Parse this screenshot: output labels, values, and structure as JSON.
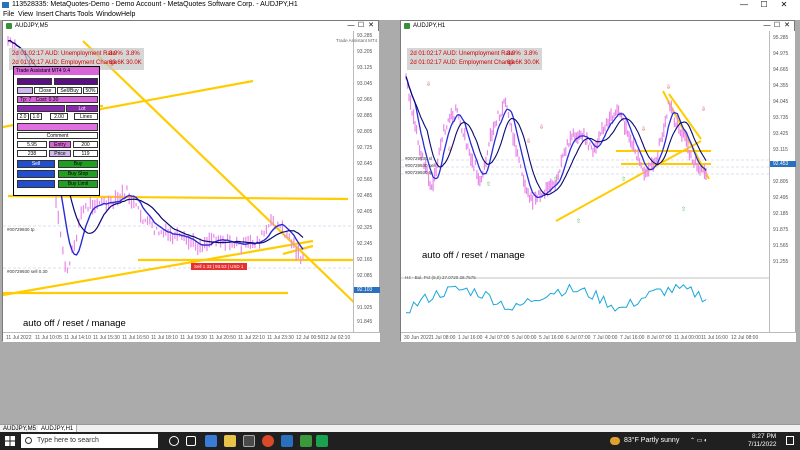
{
  "window": {
    "title": "113528335: MetaQuotes-Demo - Demo Account - MetaQuotes Software Corp. - AUDJPY,H1",
    "controls": {
      "minimize": "—",
      "maximize": "☐",
      "close": "✕"
    }
  },
  "menu": [
    "File",
    "View",
    "Insert",
    "Charts",
    "Tools",
    "Window",
    "Help"
  ],
  "chart_left": {
    "title": "AUDJPY,M5",
    "brand": "Trade Assistant MT4",
    "news": [
      {
        "time": "2d 01:02:17",
        "text": "AUD: Unemployment Rate",
        "v1": "3.9%",
        "v2": "3.8%"
      },
      {
        "time": "2d 01:02:17",
        "text": "AUD: Employment Change",
        "v1": "60.6K",
        "v2": "30.0K"
      }
    ],
    "price_ticks": [
      "93.285",
      "93.205",
      "93.125",
      "93.045",
      "92.965",
      "92.885",
      "92.805",
      "92.725",
      "92.645",
      "92.565",
      "92.485",
      "92.405",
      "92.325",
      "92.245",
      "92.165",
      "92.085",
      "92.005",
      "91.925",
      "91.845"
    ],
    "current_price": "92.103",
    "time_ticks": [
      "11 Jul 2022",
      "11 Jul 10:05",
      "11 Jul 14:10",
      "11 Jul 15:30",
      "11 Jul 16:50",
      "11 Jul 18:10",
      "11 Jul 19:30",
      "11 Jul 20:50",
      "11 Jul 22:10",
      "11 Jul 23:30",
      "12 Jul 00:50",
      "12 Jul 02:10"
    ],
    "overlay_label": "auto off / reset / manage",
    "order_label": "Sell 1 33 | 93.53 | USD 1",
    "level_tags": [
      "#00729930 tp",
      "#00729930 sell 0.30"
    ]
  },
  "chart_right": {
    "title": "AUDJPY,H1",
    "news": [
      {
        "time": "2d 01:02:17",
        "text": "AUD: Unemployment Rate",
        "v1": "3.9%",
        "v2": "3.8%"
      },
      {
        "time": "2d 01:02:17",
        "text": "AUD: Employment Change",
        "v1": "60.6K",
        "v2": "30.0K"
      }
    ],
    "price_ticks": [
      "95.285",
      "94.975",
      "94.665",
      "94.355",
      "94.045",
      "93.735",
      "93.425",
      "93.115",
      "92.805",
      "92.495",
      "92.185",
      "91.875",
      "91.565",
      "91.255"
    ],
    "current_price": "92.453",
    "indicator_label": "H4 - Bul. Pct (9,0) 27.0720 28.7575",
    "time_ticks": [
      "30 Jun 2022",
      "1 Jul 08:00",
      "1 Jul 16:00",
      "4 Jul 07:00",
      "5 Jul 00:00",
      "5 Jul 16:00",
      "6 Jul 07:00",
      "7 Jul 00:00",
      "7 Jul 16:00",
      "8 Jul 07:00",
      "11 Jul 00:00",
      "11 Jul 16:00",
      "12 Jul 08:00"
    ],
    "overlay_label": "auto off / reset / manage",
    "level_tags": [
      "#00729930 sl",
      "#00729930 sell",
      "#00729930 tp"
    ]
  },
  "trade_assistant": {
    "title": "Trade Assistant MT4 9.4",
    "close_label": "Close",
    "sellbuy_label": "Sell/Buy",
    "pct_label": "50%",
    "tp_label": "Tp: 7",
    "cost_label": "Cost: 0.30",
    "lines_label": "Lines",
    "lot_label": "Lot",
    "v1": "2.0",
    "v2": "1.0",
    "v3": "2.00",
    "comment_label": "Comment",
    "buy_stop": "Buy Stop",
    "buy_limit": "Buy Limit",
    "sell_label": "Sell",
    "buy_label": "Buy",
    "sl_val": "5.95",
    "tp_val": "200",
    "pts_val": "238",
    "price_label": "Price",
    "price_val": "119",
    "entry_label": "Entry"
  },
  "tabs": [
    "AUDJPY,M5",
    "AUDJPY,H1"
  ],
  "taskbar": {
    "search_placeholder": "Type here to search",
    "weather": "83°F  Partly sunny",
    "time": "8:27 PM",
    "date": "7/11/2022"
  },
  "colors": {
    "candle": "#e98ae9",
    "ma_fast": "#2b2bd6",
    "ma_slow": "#0a0a70",
    "trend": "#ffcc00",
    "indicator": "#19a7d9",
    "arrow_down": "#e04040",
    "arrow_up": "#40c040"
  }
}
